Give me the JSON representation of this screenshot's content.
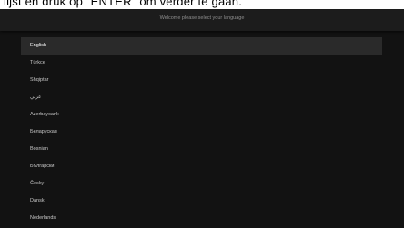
{
  "caption": "lijst en druk op \"ENTER\" om verder te gaan.",
  "header": {
    "title": "Welcome please select your language"
  },
  "languages": [
    {
      "label": "English"
    },
    {
      "label": "Türkçe"
    },
    {
      "label": "Shqiptar"
    },
    {
      "label": "عربي"
    },
    {
      "label": "Azerbaycanlı"
    },
    {
      "label": "Беларуская"
    },
    {
      "label": "Bosnian"
    },
    {
      "label": "Български"
    },
    {
      "label": "Česky"
    },
    {
      "label": "Dansk"
    },
    {
      "label": "Nederlands"
    }
  ],
  "selected_language": "English",
  "colors": {
    "screen_bg": "#121212",
    "header_bg": "#1c1c1c",
    "selected_row_bg": "#2a2a2a",
    "text": "#c8c8c8"
  }
}
